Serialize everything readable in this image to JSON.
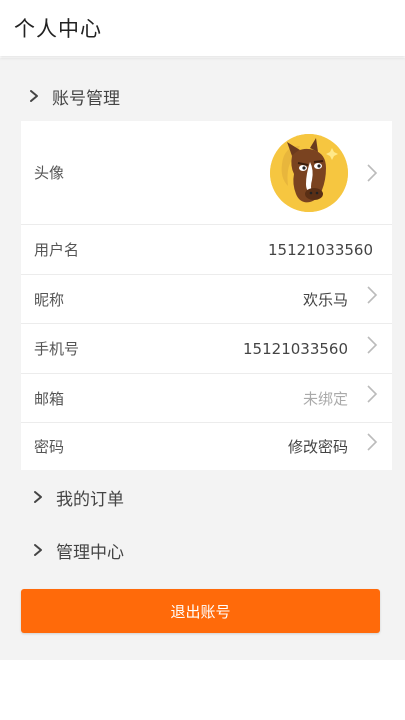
{
  "header": {
    "title": "个人中心"
  },
  "sections": {
    "account": "账号管理",
    "orders": "我的订单",
    "admin": "管理中心"
  },
  "profile": {
    "avatar_label": "头像",
    "username_label": "用户名",
    "username_value": "15121033560",
    "nickname_label": "昵称",
    "nickname_value": "欢乐马",
    "phone_label": "手机号",
    "phone_value": "15121033560",
    "email_label": "邮箱",
    "email_value": "未绑定",
    "password_label": "密码",
    "password_value": "修改密码"
  },
  "actions": {
    "logout_label": "退出账号"
  },
  "colors": {
    "accent": "#ff6a0a",
    "page_bg": "#f3f3f3",
    "card_bg": "#ffffff",
    "avatar_bg": "#f6c640"
  },
  "icons": {
    "section_chevron": "chevron-right-icon",
    "row_arrow": "arrow-right-icon",
    "avatar": "horse-avatar"
  }
}
